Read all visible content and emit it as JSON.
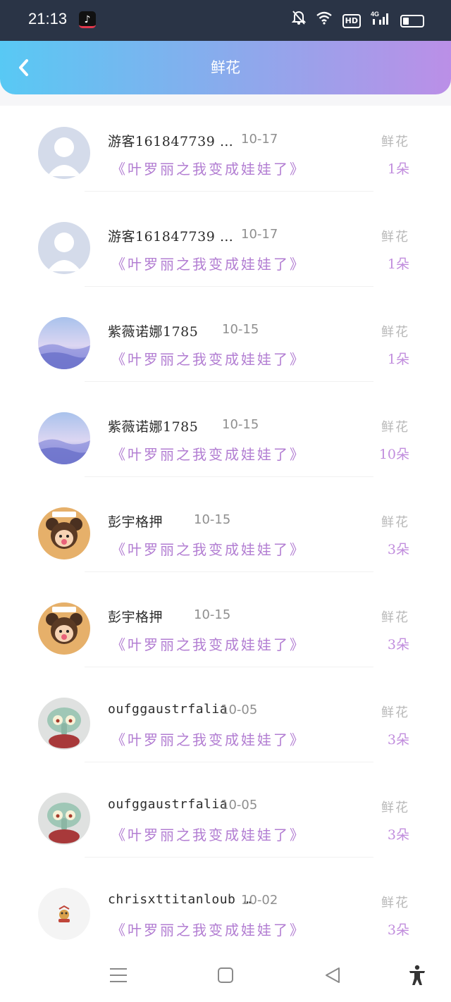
{
  "status_bar": {
    "time": "21:13",
    "app_icon": "tiktok-icon",
    "icons": [
      "mute-bell-icon",
      "wifi-icon",
      "hd-icon",
      "4g-signal-icon",
      "battery-icon"
    ],
    "hd_label": "HD",
    "network_label": "4G"
  },
  "header": {
    "title": "鲜花",
    "back_icon": "chevron-left-icon",
    "gradient": [
      "#58c9f4",
      "#bb8fe7"
    ]
  },
  "records": [
    {
      "avatar": "default-user-avatar",
      "username": "游客161847739 …",
      "date": "10-17",
      "book": "《叶罗丽之我变成娃娃了》",
      "gift": "鲜花",
      "count": "1朵"
    },
    {
      "avatar": "default-user-avatar",
      "username": "游客161847739 …",
      "date": "10-17",
      "book": "《叶罗丽之我变成娃娃了》",
      "gift": "鲜花",
      "count": "1朵"
    },
    {
      "avatar": "sky-landscape-avatar",
      "username": "紫薇诺娜1785",
      "date": "10-15",
      "book": "《叶罗丽之我变成娃娃了》",
      "gift": "鲜花",
      "count": "1朵"
    },
    {
      "avatar": "sky-landscape-avatar",
      "username": "紫薇诺娜1785",
      "date": "10-15",
      "book": "《叶罗丽之我变成娃娃了》",
      "gift": "鲜花",
      "count": "10朵"
    },
    {
      "avatar": "bear-cartoon-avatar",
      "username": "彭宇格押",
      "date": "10-15",
      "book": "《叶罗丽之我变成娃娃了》",
      "gift": "鲜花",
      "count": "3朵"
    },
    {
      "avatar": "bear-cartoon-avatar",
      "username": "彭宇格押",
      "date": "10-15",
      "book": "《叶罗丽之我变成娃娃了》",
      "gift": "鲜花",
      "count": "3朵"
    },
    {
      "avatar": "squidward-avatar",
      "username": "oufggaustrfalia",
      "date": "10-05",
      "book": "《叶罗丽之我变成娃娃了》",
      "gift": "鲜花",
      "count": "3朵"
    },
    {
      "avatar": "squidward-avatar",
      "username": "oufggaustrfalia",
      "date": "10-05",
      "book": "《叶罗丽之我变成娃娃了》",
      "gift": "鲜花",
      "count": "3朵"
    },
    {
      "avatar": "small-sticker-avatar",
      "username": "chrisxttitanloub …",
      "date": "10-02",
      "book": "《叶罗丽之我变成娃娃了》",
      "gift": "鲜花",
      "count": "3朵"
    }
  ],
  "nav_bar": {
    "icons": [
      "menu-icon",
      "home-square-icon",
      "back-triangle-icon",
      "accessibility-icon"
    ]
  },
  "colors": {
    "book_title": "#b27dd2",
    "gift_count": "#c18ddd",
    "gift_label": "#b8b8b8"
  }
}
